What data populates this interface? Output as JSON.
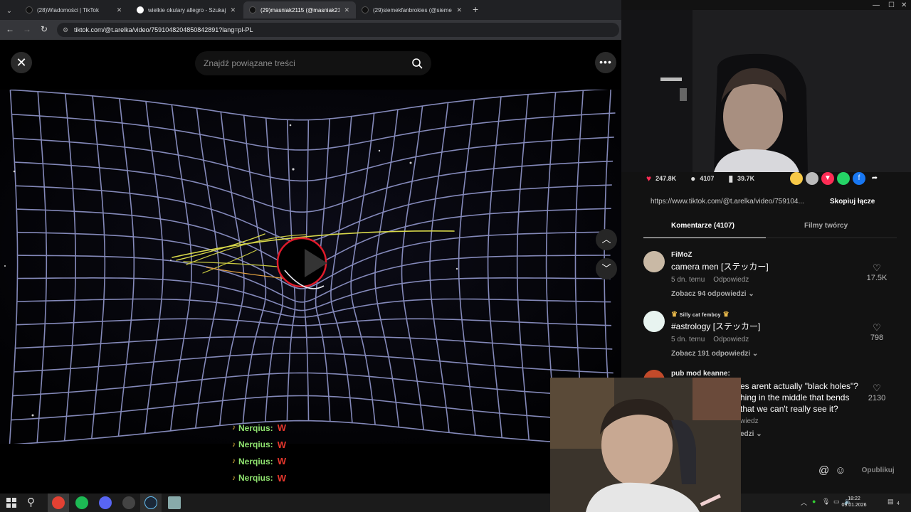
{
  "browser": {
    "tabs": [
      {
        "label": "(28)Wiadomości | TikTok",
        "active": false
      },
      {
        "label": "wielkie okulary allegro - Szukaj",
        "active": false
      },
      {
        "label": "(29)masniak2115 (@masniak21",
        "active": true
      },
      {
        "label": "(29)siemekfanbrokies (@siemek",
        "active": false
      }
    ],
    "new_tab": "+",
    "url": "tiktok.com/@t.arelka/video/7591048204850842891?lang=pl-PL"
  },
  "video_view": {
    "search_placeholder": "Znajdź powiązane treści",
    "close_symbol": "✕",
    "more_symbol": "•••",
    "up_symbol": "︿",
    "down_symbol": "﹀"
  },
  "chat_overlay": [
    {
      "user": "Nerqius:",
      "message": "W"
    },
    {
      "user": "Nerqius:",
      "message": "W"
    },
    {
      "user": "Nerqius:",
      "message": "W"
    },
    {
      "user": "Nerqius:",
      "message": "W"
    }
  ],
  "engagement": {
    "likes": "247.8K",
    "comments": "4107",
    "saves": "39.7K"
  },
  "share": {
    "link": "https://www.tiktok.com/@t.arelka/video/759104...",
    "copy_label": "Skopiuj łącze"
  },
  "panel_tabs": {
    "comments": "Komentarze (4107)",
    "creator_videos": "Filmy twórcy"
  },
  "comments": [
    {
      "user": "FiMoZ",
      "text": "camera men [ステッカー]",
      "time": "5 dn. temu",
      "reply_label": "Odpowiedz",
      "view_replies": "Zobacz 94 odpowiedzi",
      "likes": "17.5K"
    },
    {
      "user": "Silly cat femboy",
      "text": "#astrology [ステッカー]",
      "time": "5 dn. temu",
      "reply_label": "Odpowiedz",
      "view_replies": "Zobacz 191 odpowiedzi",
      "likes": "798"
    },
    {
      "user": "pub mod keanne:",
      "text": "es arent actually \"black holes\"? hing in the middle that bends that we can't really see it?",
      "meta": "wiedz",
      "view_replies": "edzi",
      "likes": "2130"
    }
  ],
  "composer": {
    "publish_label": "Opublikuj"
  },
  "system": {
    "time": "18:22",
    "date": "09.01.2026",
    "notification_count": "4"
  }
}
